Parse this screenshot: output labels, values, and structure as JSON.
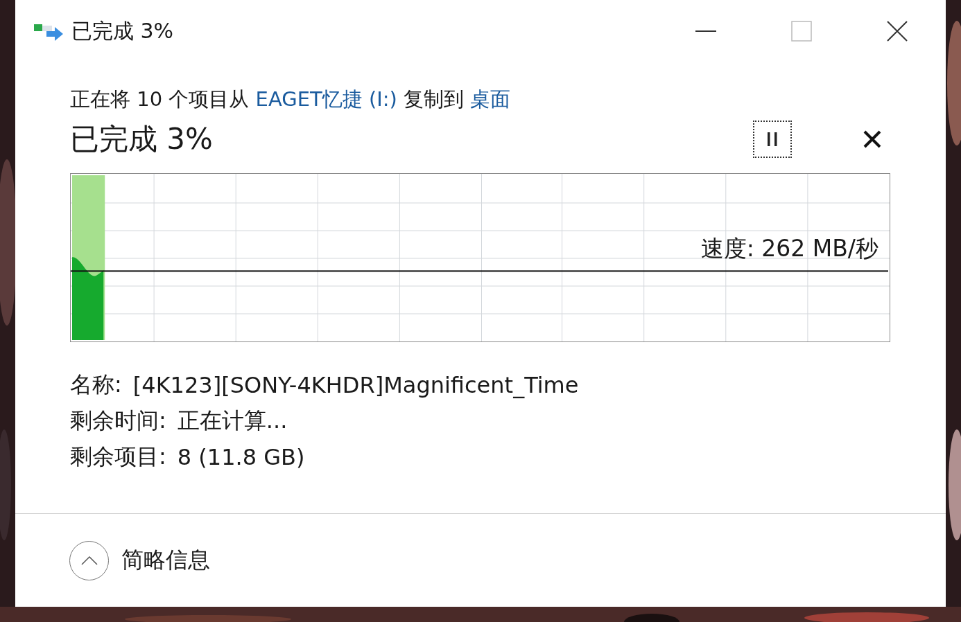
{
  "window": {
    "title": "已完成 3%"
  },
  "description": [
    {
      "kind": "text",
      "text": "正在将 10 个项目从 "
    },
    {
      "kind": "link",
      "text": "EAGET忆捷 (I:)"
    },
    {
      "kind": "text",
      "text": " 复制到 "
    },
    {
      "kind": "link",
      "text": "桌面"
    }
  ],
  "heading": "已完成 3%",
  "progress": {
    "level": 0.04
  },
  "speed_line": {
    "level": 0.42
  },
  "speed": "速度: 262 MB/秒",
  "details": [
    {
      "label": "名称:",
      "value": "[4K123][SONY-4KHDR]Magnificent_Time"
    },
    {
      "label": "剩余时间:",
      "value": "正在计算..."
    },
    {
      "label": "剩余项目:",
      "value": "8 (11.8 GB)"
    }
  ],
  "footer": {
    "label": "简略信息",
    "expanded": true
  }
}
